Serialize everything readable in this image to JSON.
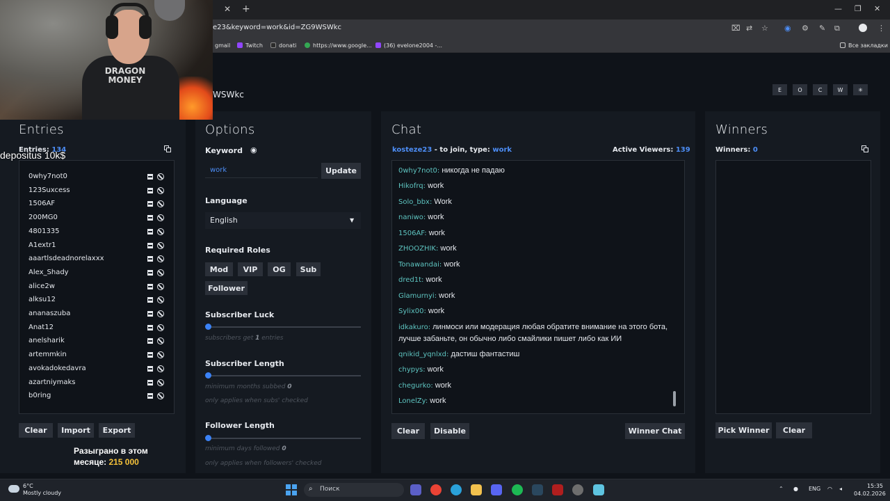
{
  "browser": {
    "url": "e23&keyword=work&id=ZG9WSWkc",
    "bookmarks": [
      "gmail",
      "Twitch",
      "donati",
      "https://www.google...",
      "(36) evelone2004 -..."
    ],
    "all_bookmarks": "Все закладки"
  },
  "page": {
    "title_fragment": "WSWkc",
    "top_buttons": [
      "E",
      "O",
      "C",
      "W",
      "✳"
    ]
  },
  "overlay": {
    "deposit_text": "depositus 10k$",
    "raffle_line1": "Разыграно в этом",
    "raffle_line2_prefix": "месяце: ",
    "raffle_amount": "215 000",
    "shirt_text": "DRAGON MONEY"
  },
  "entries": {
    "title": "Entries",
    "count_label": "Entries: ",
    "count": "134",
    "items": [
      "0why7not0",
      "123Suxcess",
      "1506AF",
      "200MG0",
      "4801335",
      "A1extr1",
      "aaartlsdeadnorelaxxx",
      "Alex_Shady",
      "alice2w",
      "alksu12",
      "ananaszuba",
      "Anat12",
      "anelsharik",
      "artemmkin",
      "avokadokedavra",
      "azartniymaks",
      "b0ring"
    ],
    "buttons": {
      "clear": "Clear",
      "import": "Import",
      "export": "Export"
    }
  },
  "options": {
    "title": "Options",
    "keyword_label": "Keyword",
    "keyword_value": "work",
    "update_button": "Update",
    "language_label": "Language",
    "language_value": "English",
    "roles_label": "Required Roles",
    "roles": [
      "Mod",
      "VIP",
      "OG",
      "Sub",
      "Follower"
    ],
    "sub_luck_label": "Subscriber Luck",
    "sub_luck_hint_pre": "subscribers get ",
    "sub_luck_value": "1",
    "sub_luck_hint_post": " entries",
    "sub_luck_fraction": 0,
    "sub_length_label": "Subscriber Length",
    "sub_length_hint_pre": "minimum months subbed ",
    "sub_length_value": "0",
    "sub_length_note": "only applies when subs' checked",
    "sub_length_fraction": 0,
    "fol_length_label": "Follower Length",
    "fol_length_hint_pre": "minimum days followed ",
    "fol_length_value": "0",
    "fol_length_note": "only applies when followers' checked",
    "fol_length_fraction": 0
  },
  "chat": {
    "title": "Chat",
    "join_user": "kosteze23",
    "join_text": " - to join, type: ",
    "join_keyword": "work",
    "viewers_label": "Active Viewers: ",
    "viewers_count": "139",
    "messages": [
      {
        "user": "0why7not0:",
        "text": " никогда не падаю"
      },
      {
        "user": "Hikofrq:",
        "text": " work"
      },
      {
        "user": "Solo_bbx:",
        "text": " Work"
      },
      {
        "user": "naniwo:",
        "text": " work"
      },
      {
        "user": "1506AF:",
        "text": " work"
      },
      {
        "user": "ZHOOZHIK:",
        "text": " work"
      },
      {
        "user": "Tonawandai:",
        "text": " work"
      },
      {
        "user": "dred1t:",
        "text": " work"
      },
      {
        "user": "Glamurnyi:",
        "text": " work"
      },
      {
        "user": "Sylix00:",
        "text": " work"
      },
      {
        "user": "idkakuro:",
        "text": " линмоси или модерация любая обратите внимание на этого бота, лучше забаньте, он обычно либо смайлики пишет либо как ИИ"
      },
      {
        "user": "qnikid_yqnlxd:",
        "text": " дастиш фантастиш"
      },
      {
        "user": "chypys:",
        "text": " work"
      },
      {
        "user": "chegurko:",
        "text": " work"
      },
      {
        "user": "LonelZy:",
        "text": " work"
      }
    ],
    "buttons": {
      "clear": "Clear",
      "disable": "Disable",
      "winner_chat": "Winner Chat"
    }
  },
  "winners": {
    "title": "Winners",
    "count_label": "Winners: ",
    "count": "0",
    "buttons": {
      "pick": "Pick Winner",
      "clear": "Clear"
    }
  },
  "taskbar": {
    "weather_temp": "6°C",
    "weather_desc": "Mostly cloudy",
    "search_placeholder": "Поиск",
    "lang": "ENG",
    "time": "15:35",
    "date": "04.02.2026"
  },
  "colors": {
    "accent": "#3b82f6",
    "chat_user": "#5ec4c0",
    "panel": "#151a21",
    "bg": "#0f1319",
    "button": "#2b3039"
  }
}
